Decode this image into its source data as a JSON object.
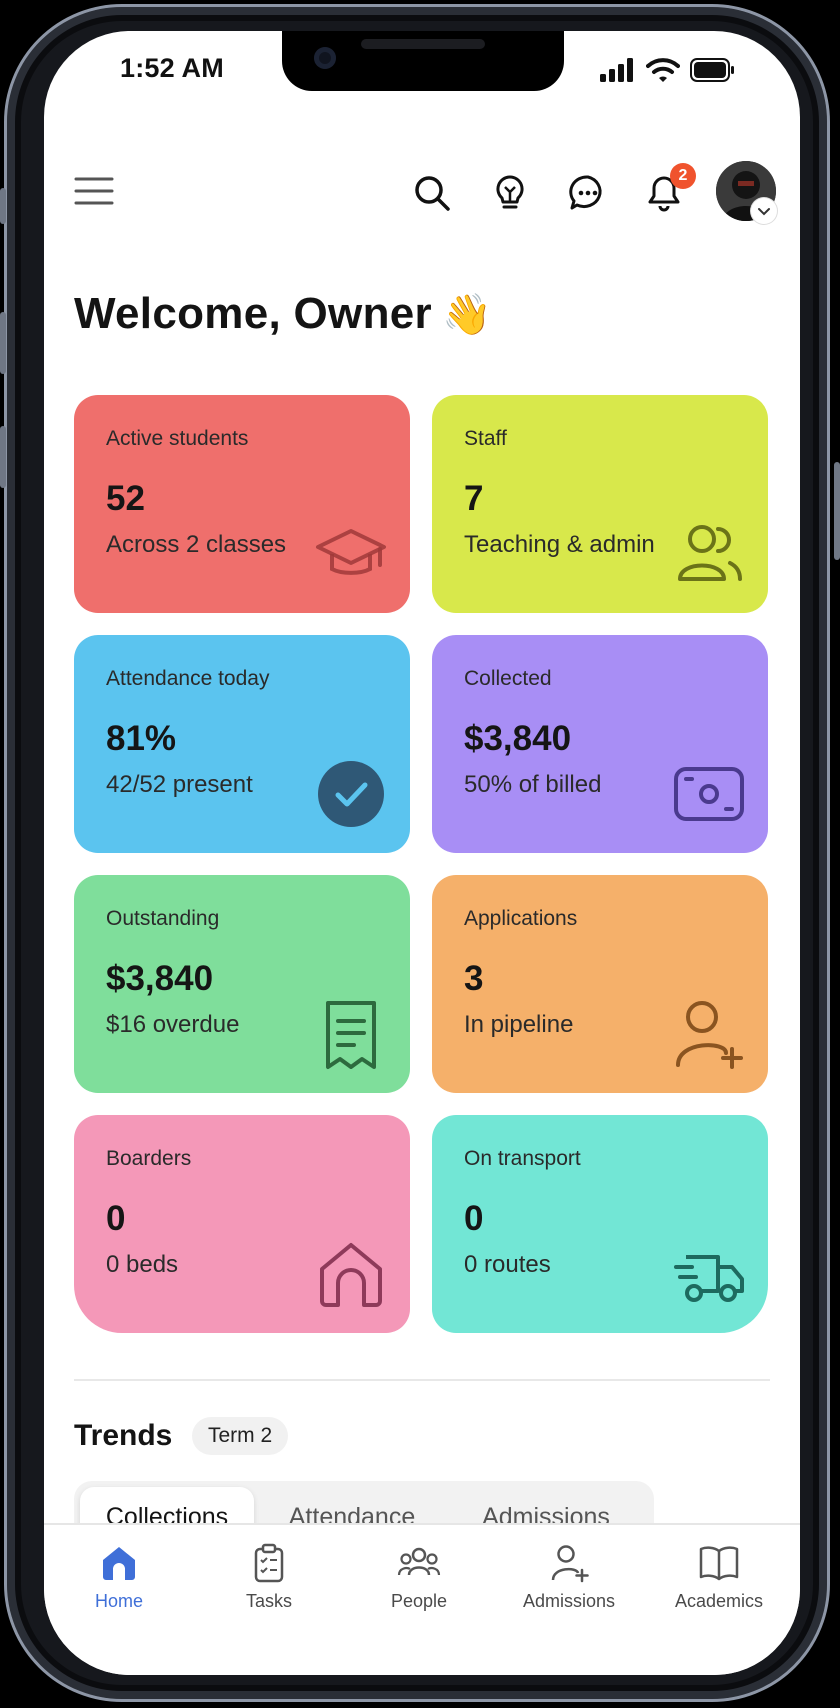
{
  "status_bar": {
    "time": "1:52 AM"
  },
  "header": {
    "notification_count": "2"
  },
  "welcome": {
    "title": "Welcome, Owner",
    "emoji": "👋"
  },
  "cards": [
    {
      "title": "Active students",
      "value": "52",
      "subtitle": "Across 2 classes",
      "icon": "graduation-cap-icon",
      "color": "#ef6f6c"
    },
    {
      "title": "Staff",
      "value": "7",
      "subtitle": "Teaching & admin",
      "icon": "users-icon",
      "color": "#d8e84b"
    },
    {
      "title": "Attendance today",
      "value": "81%",
      "subtitle": "42/52 present",
      "icon": "check-circle-icon",
      "color": "#5bc4ef"
    },
    {
      "title": "Collected",
      "value": "$3,840",
      "subtitle": "50% of billed",
      "icon": "cash-icon",
      "color": "#a88ef5"
    },
    {
      "title": "Outstanding",
      "value": "$3,840",
      "subtitle": "$16 overdue",
      "icon": "receipt-icon",
      "color": "#7fde9b"
    },
    {
      "title": "Applications",
      "value": "3",
      "subtitle": "In pipeline",
      "icon": "user-plus-icon",
      "color": "#f5b06a"
    },
    {
      "title": "Boarders",
      "value": "0",
      "subtitle": "0 beds",
      "icon": "home-icon",
      "color": "#f498b8"
    },
    {
      "title": "On transport",
      "value": "0",
      "subtitle": "0 routes",
      "icon": "truck-icon",
      "color": "#72e6d5"
    }
  ],
  "trends": {
    "title": "Trends",
    "term": "Term 2",
    "tabs": [
      "Collections",
      "Attendance",
      "Admissions"
    ],
    "active_tab": "Collections"
  },
  "bottom_nav": {
    "items": [
      {
        "label": "Home",
        "icon": "home-icon",
        "active": true
      },
      {
        "label": "Tasks",
        "icon": "clipboard-check-icon"
      },
      {
        "label": "People",
        "icon": "people-icon"
      },
      {
        "label": "Admissions",
        "icon": "user-plus-icon"
      },
      {
        "label": "Academics",
        "icon": "book-icon"
      }
    ],
    "active_color": "#3f6fd8"
  }
}
